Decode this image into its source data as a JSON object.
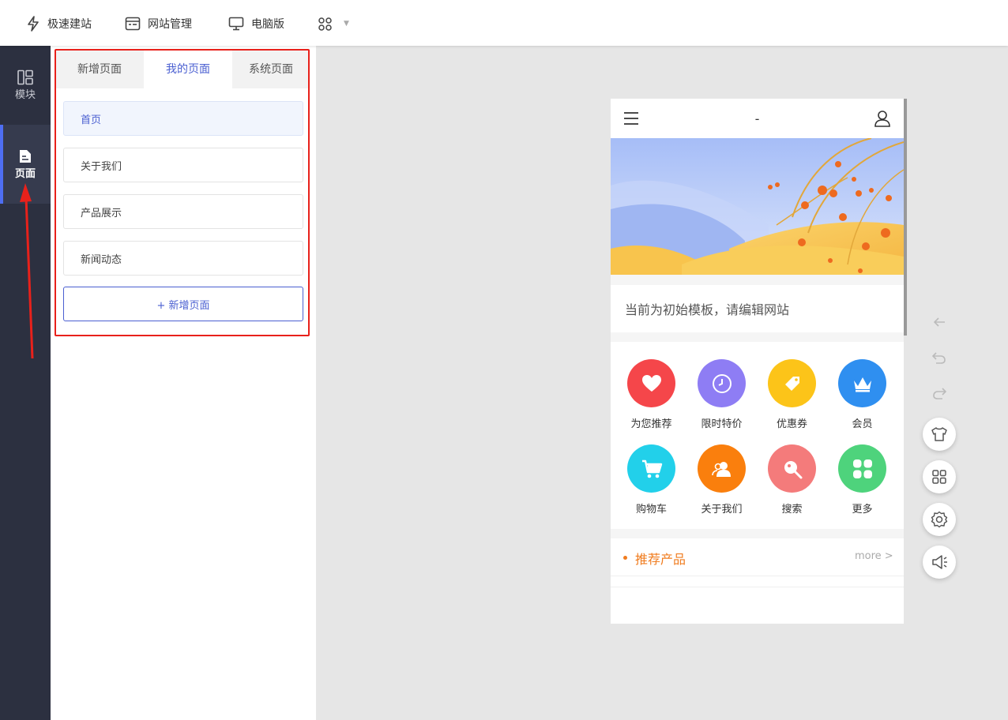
{
  "topbar": {
    "items": [
      {
        "label": "极速建站",
        "icon": "lightning-icon"
      },
      {
        "label": "网站管理",
        "icon": "site-manage-icon"
      },
      {
        "label": "电脑版",
        "icon": "desktop-icon"
      },
      {
        "label": "",
        "icon": "apps-grid-icon"
      }
    ]
  },
  "rail": {
    "items": [
      {
        "label": "模块",
        "icon": "modules-icon"
      },
      {
        "label": "页面",
        "icon": "page-icon",
        "active": true
      }
    ]
  },
  "panel": {
    "tabs": [
      {
        "label": "新增页面"
      },
      {
        "label": "我的页面",
        "active": true
      },
      {
        "label": "系统页面"
      }
    ],
    "pages": [
      {
        "label": "首页",
        "active": true
      },
      {
        "label": "关于我们"
      },
      {
        "label": "产品展示"
      },
      {
        "label": "新闻动态"
      }
    ],
    "add_page_label": "+ 新增页面"
  },
  "phone": {
    "title": "-",
    "notice": "当前为初始模板，请编辑网站",
    "icons": [
      {
        "label": "为您推荐",
        "icon": "heart-icon",
        "color": "#f5464a"
      },
      {
        "label": "限时特价",
        "icon": "clock-icon",
        "color": "#8e7df4"
      },
      {
        "label": "优惠券",
        "icon": "tag-icon",
        "color": "#fcc419"
      },
      {
        "label": "会员",
        "icon": "crown-icon",
        "color": "#2f8ff0"
      },
      {
        "label": "购物车",
        "icon": "cart-icon",
        "color": "#22d0ea"
      },
      {
        "label": "关于我们",
        "icon": "people-icon",
        "color": "#fa7f0d"
      },
      {
        "label": "搜索",
        "icon": "search-icon",
        "color": "#f47b7b"
      },
      {
        "label": "更多",
        "icon": "more-grid-icon",
        "color": "#4ed37c"
      }
    ],
    "recommend": {
      "title": "推荐产品",
      "more": "more >"
    }
  },
  "colors": {
    "accent": "#4a5fd1",
    "rail_bg": "#2c3040",
    "highlight": "#e8211b",
    "recommend": "#f07c1f"
  },
  "tools": [
    "back-arrow-icon",
    "undo-icon",
    "redo-icon",
    "shirt-icon",
    "apps-grid-icon",
    "settings-icon",
    "speaker-icon"
  ]
}
